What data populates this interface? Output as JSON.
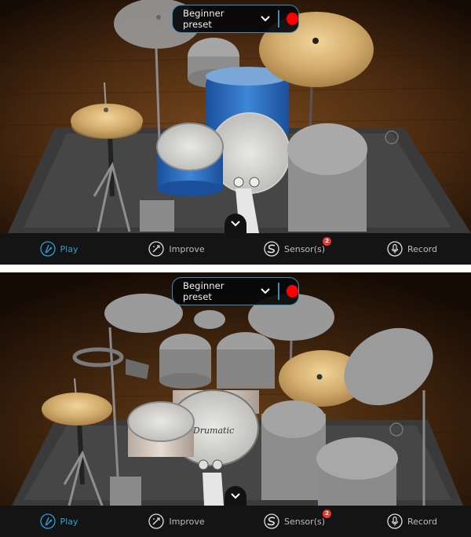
{
  "screens": [
    {
      "preset": {
        "label": "Beginner preset",
        "record_color": "#ff0000"
      },
      "kit_theme": "blue-sparkle",
      "nav": {
        "active": "play",
        "items": [
          {
            "id": "play",
            "label": "Play",
            "icon": "drumsticks-icon"
          },
          {
            "id": "improve",
            "label": "Improve",
            "icon": "magic-wand-icon"
          },
          {
            "id": "sensors",
            "label": "Sensor(s)",
            "icon": "sensor-logo-icon",
            "badge": "2"
          },
          {
            "id": "record",
            "label": "Record",
            "icon": "microphone-icon"
          }
        ]
      }
    },
    {
      "preset": {
        "label": "Beginner preset",
        "record_color": "#ff0000"
      },
      "kit_theme": "white-pearl",
      "kit_brand": "Drumatic",
      "nav": {
        "active": "play",
        "items": [
          {
            "id": "play",
            "label": "Play",
            "icon": "drumsticks-icon"
          },
          {
            "id": "improve",
            "label": "Improve",
            "icon": "magic-wand-icon"
          },
          {
            "id": "sensors",
            "label": "Sensor(s)",
            "icon": "sensor-logo-icon",
            "badge": "2"
          },
          {
            "id": "record",
            "label": "Record",
            "icon": "microphone-icon"
          }
        ]
      }
    }
  ],
  "colors": {
    "accent": "#2b9fd6",
    "border_accent": "#3c8fb4",
    "badge": "#e53935",
    "nav_bg": "#141414",
    "text_inactive": "#bdbdbd"
  }
}
